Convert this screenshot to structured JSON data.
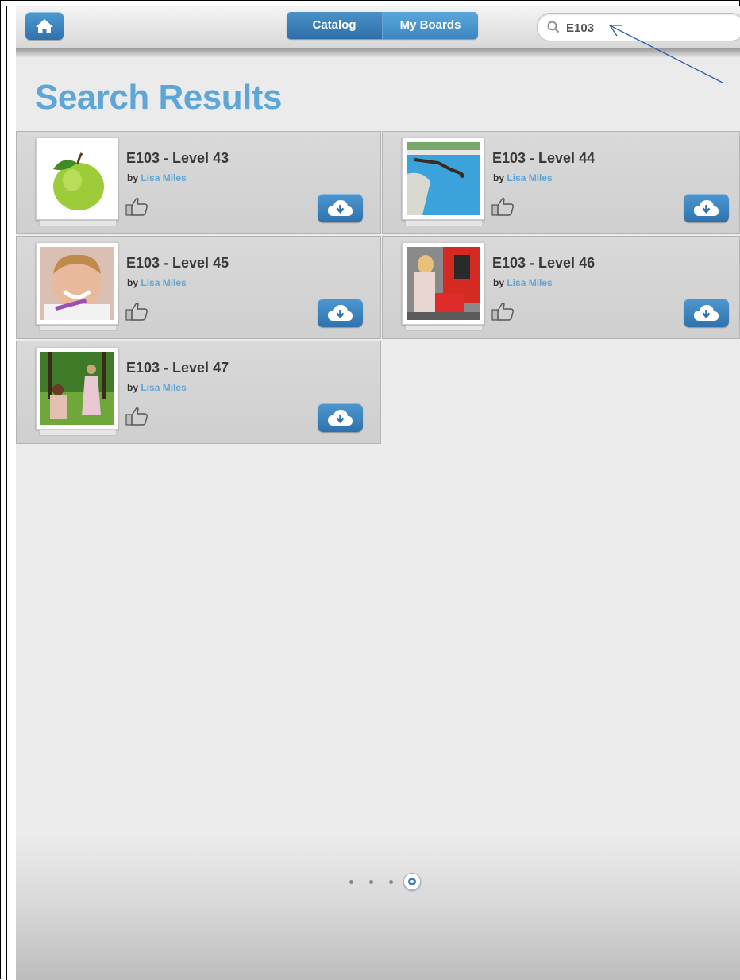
{
  "header": {
    "home_icon": "home-icon",
    "tabs": [
      {
        "label": "Catalog"
      },
      {
        "label": "My Boards"
      }
    ],
    "search": {
      "value": "E103",
      "icon": "search-icon"
    }
  },
  "page_title": "Search Results",
  "results": [
    {
      "title": "E103 - Level 43",
      "by": "by",
      "author": "Lisa Miles",
      "thumb": "green apple"
    },
    {
      "title": "E103 - Level 44",
      "by": "by",
      "author": "Lisa Miles",
      "thumb": "diver over pool"
    },
    {
      "title": "E103 - Level 45",
      "by": "by",
      "author": "Lisa Miles",
      "thumb": "smiling girl brushing teeth"
    },
    {
      "title": "E103 - Level 46",
      "by": "by",
      "author": "Lisa Miles",
      "thumb": "women at store"
    },
    {
      "title": "E103 - Level 47",
      "by": "by",
      "author": "Lisa Miles",
      "thumb": "woman and child in park"
    }
  ],
  "pagination": {
    "pages": 4,
    "current": 4
  },
  "colors": {
    "accent": "#5ea6d6",
    "button": "#2f72ad"
  }
}
